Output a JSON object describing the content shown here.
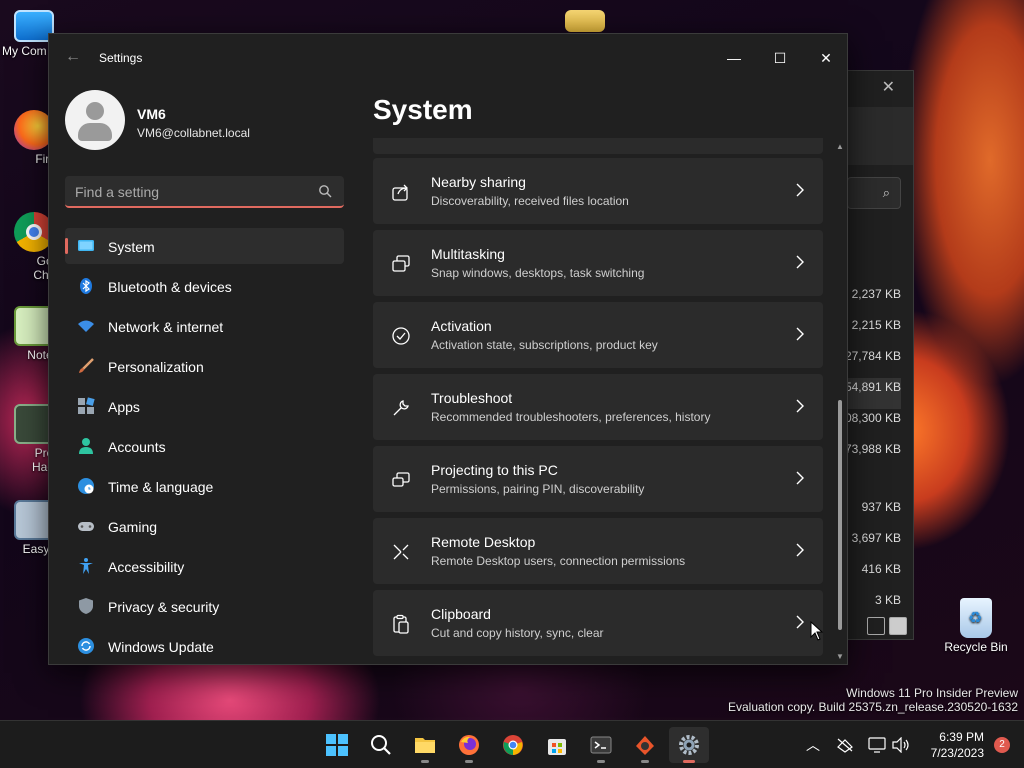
{
  "desktop": {
    "icons": [
      {
        "label": "My Com",
        "icon": "monitor-icon"
      },
      {
        "label": "Firefo",
        "icon": "firefox-icon"
      },
      {
        "label": "Goog\nChron",
        "icon": "chrome-icon"
      },
      {
        "label": "Notepa",
        "icon": "notepad-icon"
      },
      {
        "label": "Proce\nHacke",
        "icon": "process-hacker-icon"
      },
      {
        "label": "EasyBC",
        "icon": "easybcd-icon"
      },
      {
        "label": "Recycle Bin",
        "icon": "recycle-bin-icon"
      }
    ],
    "watermark_line1": "Windows 11 Pro Insider Preview",
    "watermark_line2": "Evaluation copy. Build 25375.zn_release.230520-1632"
  },
  "background_window": {
    "sizes": [
      "2,237 KB",
      "2,215 KB",
      "27,784 KB",
      "54,891 KB",
      "08,300 KB",
      "73,988 KB",
      "",
      "937 KB",
      "3,697 KB",
      "416 KB",
      "3 KB"
    ]
  },
  "settings": {
    "window_title": "Settings",
    "user": {
      "name": "VM6",
      "email": "VM6@collabnet.local"
    },
    "search_placeholder": "Find a setting",
    "nav": [
      {
        "label": "System",
        "icon": "system-icon",
        "active": true
      },
      {
        "label": "Bluetooth & devices",
        "icon": "bluetooth-icon"
      },
      {
        "label": "Network & internet",
        "icon": "wifi-icon"
      },
      {
        "label": "Personalization",
        "icon": "brush-icon"
      },
      {
        "label": "Apps",
        "icon": "apps-icon"
      },
      {
        "label": "Accounts",
        "icon": "accounts-icon"
      },
      {
        "label": "Time & language",
        "icon": "globe-clock-icon"
      },
      {
        "label": "Gaming",
        "icon": "gamepad-icon"
      },
      {
        "label": "Accessibility",
        "icon": "accessibility-icon"
      },
      {
        "label": "Privacy & security",
        "icon": "shield-icon"
      },
      {
        "label": "Windows Update",
        "icon": "update-icon"
      }
    ],
    "page_title": "System",
    "items": [
      {
        "title": "Nearby sharing",
        "subtitle": "Discoverability, received files location",
        "icon": "share-icon"
      },
      {
        "title": "Multitasking",
        "subtitle": "Snap windows, desktops, task switching",
        "icon": "multitasking-icon"
      },
      {
        "title": "Activation",
        "subtitle": "Activation state, subscriptions, product key",
        "icon": "activation-icon"
      },
      {
        "title": "Troubleshoot",
        "subtitle": "Recommended troubleshooters, preferences, history",
        "icon": "wrench-icon"
      },
      {
        "title": "Projecting to this PC",
        "subtitle": "Permissions, pairing PIN, discoverability",
        "icon": "projecting-icon"
      },
      {
        "title": "Remote Desktop",
        "subtitle": "Remote Desktop users, connection permissions",
        "icon": "remote-desktop-icon"
      },
      {
        "title": "Clipboard",
        "subtitle": "Cut and copy history, sync, clear",
        "icon": "clipboard-icon"
      }
    ]
  },
  "taskbar": {
    "apps": [
      "start-icon",
      "search-icon",
      "file-explorer-icon",
      "firefox-icon",
      "chrome-icon",
      "store-icon",
      "terminal-icon",
      "app-icon",
      "settings-icon"
    ],
    "time": "6:39 PM",
    "date": "7/23/2023",
    "notification_count": "2"
  },
  "colors": {
    "accent": "#e06a5f",
    "window_bg": "#202020",
    "card_bg": "#2b2b2b"
  }
}
